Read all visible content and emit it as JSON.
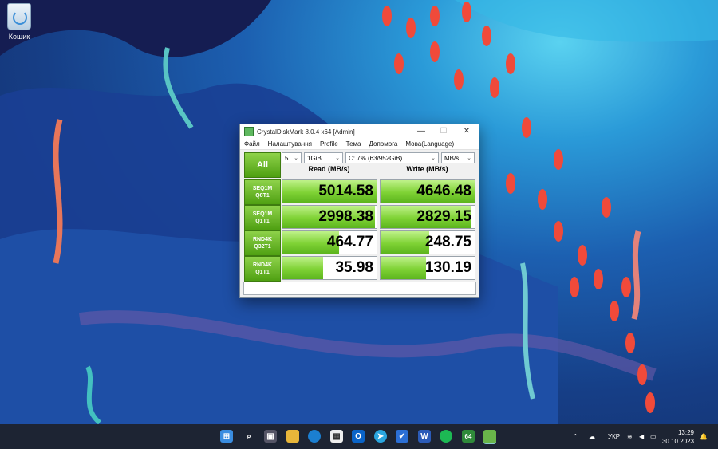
{
  "desktop": {
    "recycle_bin_label": "Кошик"
  },
  "window": {
    "title": "CrystalDiskMark 8.0.4 x64 [Admin]",
    "minimize_glyph": "—",
    "maximize_glyph": "☐",
    "close_glyph": "✕",
    "menu": [
      "Файл",
      "Налаштування",
      "Profile",
      "Тема",
      "Допомога",
      "Мова(Language)"
    ],
    "all_button": "All",
    "count_select": "5",
    "size_select": "1GiB",
    "drive_select": "C: 7% (63/952GiB)",
    "unit_select": "MB/s",
    "read_header": "Read (MB/s)",
    "write_header": "Write (MB/s)",
    "tests": [
      {
        "line1": "SEQ1M",
        "line2": "Q8T1",
        "read": "5014.58",
        "write": "4646.48",
        "read_fill": 1.0,
        "write_fill": 1.0
      },
      {
        "line1": "SEQ1M",
        "line2": "Q1T1",
        "read": "2998.38",
        "write": "2829.15",
        "read_fill": 0.98,
        "write_fill": 0.97
      },
      {
        "line1": "RND4K",
        "line2": "Q32T1",
        "read": "464.77",
        "write": "248.75",
        "read_fill": 0.6,
        "write_fill": 0.52
      },
      {
        "line1": "RND4K",
        "line2": "Q1T1",
        "read": "35.98",
        "write": "130.19",
        "read_fill": 0.43,
        "write_fill": 0.48
      }
    ]
  },
  "taskbar": {
    "language": "УКР",
    "time": "13:29",
    "date": "30.10.2023",
    "app_badge_64": "64"
  },
  "colors": {
    "accent_green": "#5cb51d",
    "taskbar_bg": "#1d2433"
  }
}
